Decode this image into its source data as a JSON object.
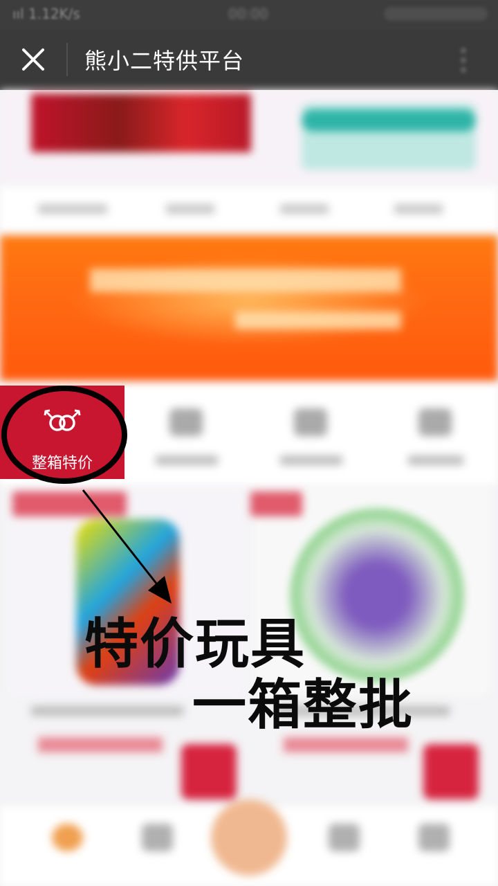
{
  "status_bar": {
    "signal_text": "ııl 1.12K/s"
  },
  "titlebar": {
    "title": "熊小二特供平台",
    "close_icon": "close-icon",
    "menu_icon": "more-icon"
  },
  "featured_category": {
    "label": "整箱特价",
    "icon": "double-ring-icon",
    "color": "#c81631"
  },
  "annotation": {
    "line1": "特价玩具",
    "line2": "一箱整批",
    "ring_color": "#000000"
  },
  "colors": {
    "banner": "#ff6a12",
    "accent_red": "#d6243f",
    "topbar": "#3a3a3a"
  }
}
